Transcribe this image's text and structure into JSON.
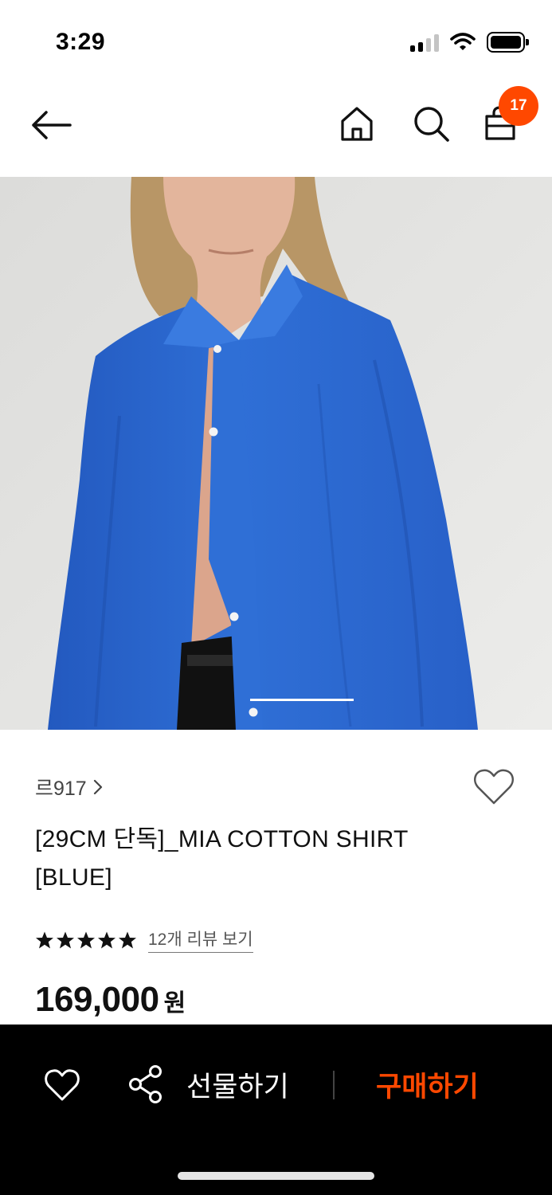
{
  "status": {
    "time": "3:29"
  },
  "header": {
    "cart_count": "17"
  },
  "product": {
    "brand": "르917",
    "title": "[29CM 단독]_MIA COTTON SHIRT [BLUE]",
    "review_link": "12개 리뷰 보기",
    "rating": 5,
    "price": "169,000",
    "currency": "원",
    "image": {
      "image_index": 1,
      "image_count": 1
    }
  },
  "actions": {
    "gift_label": "선물하기",
    "buy_label": "구매하기"
  },
  "colors": {
    "accent": "#ff4800",
    "shirt_blue": "#2f6fd6",
    "bottom_bar": "#000000"
  }
}
